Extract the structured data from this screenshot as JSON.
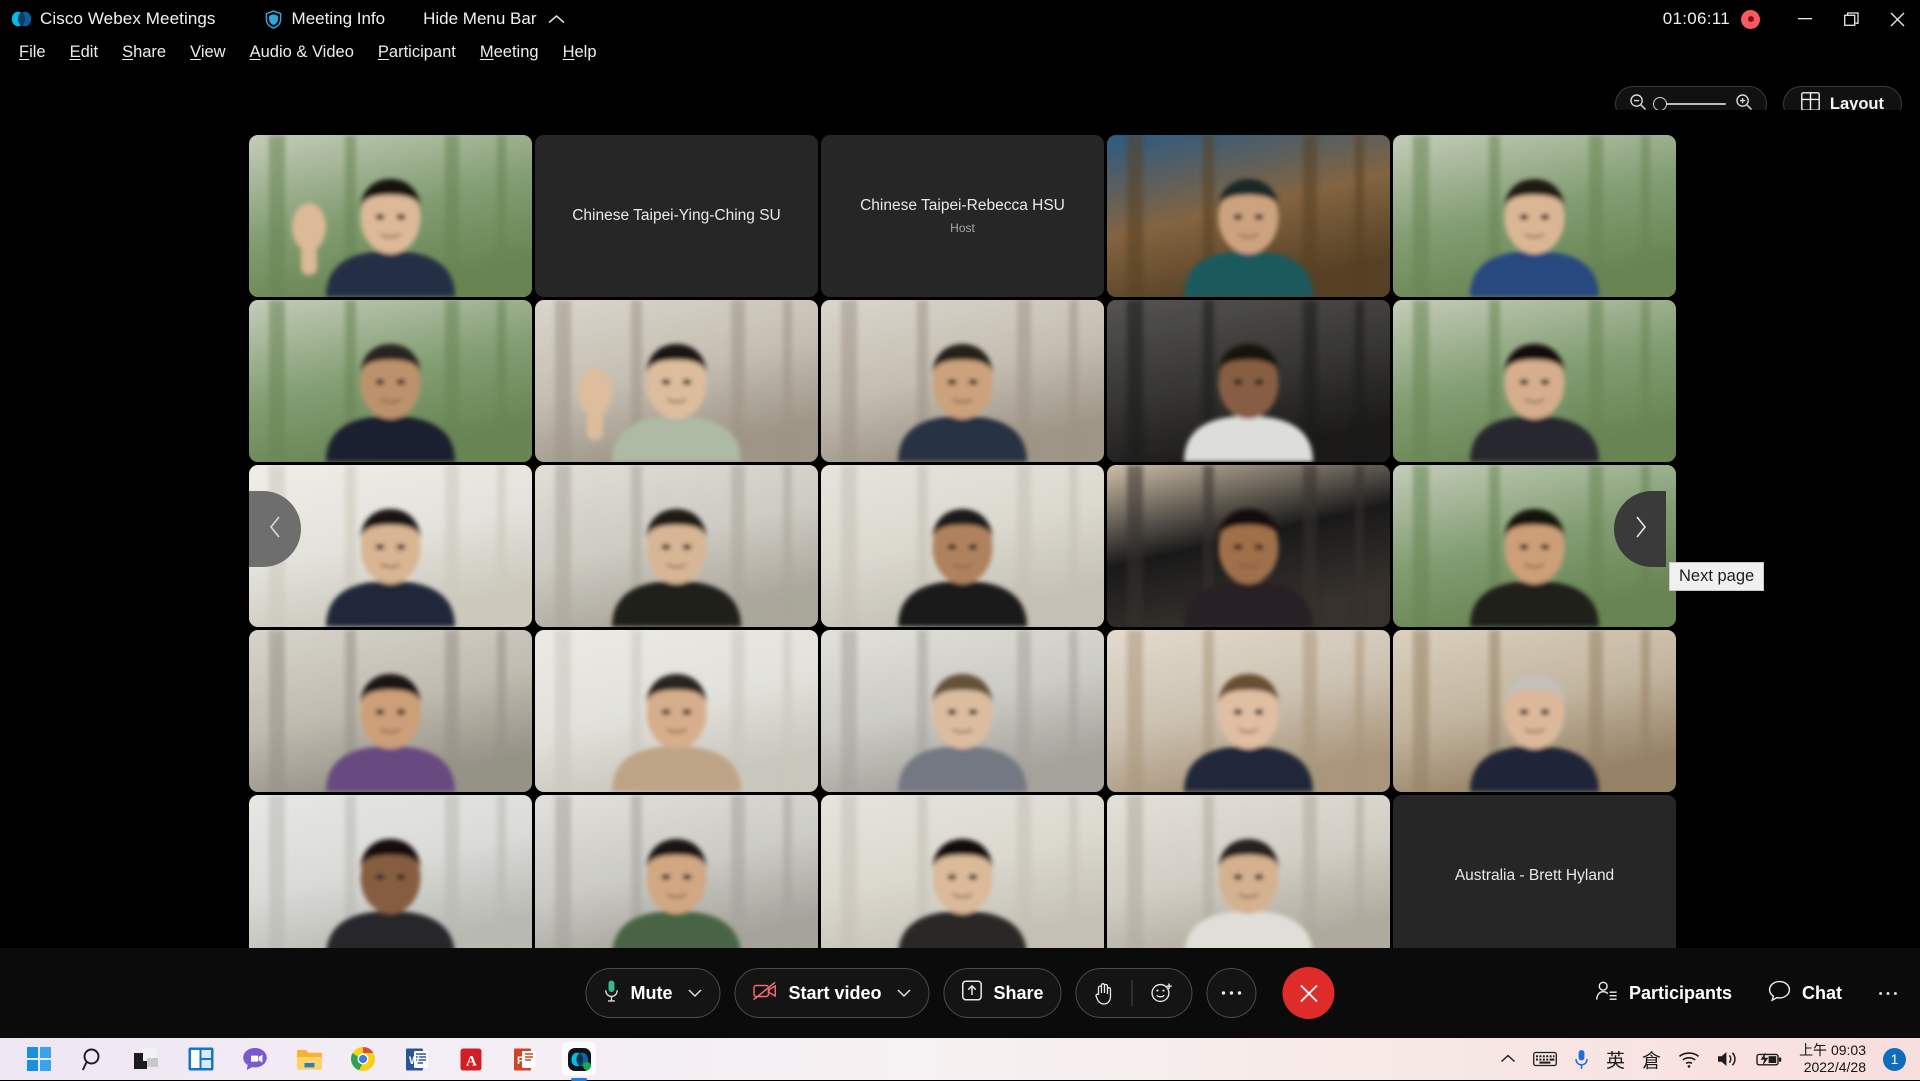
{
  "titlebar": {
    "app_title": "Cisco Webex Meetings",
    "logo_icon": "webex-logo-icon",
    "meeting_info_label": "Meeting Info",
    "meeting_info_icon": "shield-icon",
    "hide_menu_bar_label": "Hide Menu Bar",
    "hide_menu_bar_icon": "chevron-up-icon",
    "timer": "01:06:11",
    "recording_icon": "recording-indicator-icon",
    "minimize_icon": "minimize-icon",
    "restore_icon": "restore-icon",
    "close_icon": "close-icon",
    "accent_recording": "#fa5a5f"
  },
  "menubar": {
    "items": [
      {
        "label": "File",
        "accel": "F"
      },
      {
        "label": "Edit",
        "accel": "E"
      },
      {
        "label": "Share",
        "accel": "S"
      },
      {
        "label": "View",
        "accel": "V"
      },
      {
        "label": "Audio & Video",
        "accel": "A"
      },
      {
        "label": "Participant",
        "accel": "P"
      },
      {
        "label": "Meeting",
        "accel": "M"
      },
      {
        "label": "Help",
        "accel": "H"
      }
    ]
  },
  "topcontrols": {
    "zoom_out_icon": "zoom-out-icon",
    "zoom_in_icon": "zoom-in-icon",
    "zoom_value": 0,
    "layout_label": "Layout",
    "layout_icon": "grid-layout-icon"
  },
  "stage": {
    "prev_page_icon": "chevron-left-icon",
    "next_page_icon": "chevron-right-icon",
    "next_page_tooltip": "Next page",
    "grid_columns": 5,
    "grid_rows": 5,
    "tiles": [
      {
        "type": "video",
        "bg": "forest",
        "subject": "man-waving-glasses"
      },
      {
        "type": "name",
        "name": "Chinese Taipei-Ying-Ching SU",
        "role": ""
      },
      {
        "type": "name",
        "name": "Chinese Taipei-Rebecca HSU",
        "role": "Host"
      },
      {
        "type": "video",
        "bg": "office-flag",
        "subject": "woman-hijab-teal"
      },
      {
        "type": "video",
        "bg": "forest",
        "subject": "woman-blue-top"
      },
      {
        "type": "video",
        "bg": "forest",
        "subject": "man-suit-tie"
      },
      {
        "type": "video",
        "bg": "office",
        "subject": "man-mask-waving"
      },
      {
        "type": "video",
        "bg": "office",
        "subject": "man-navy-shirt"
      },
      {
        "type": "video",
        "bg": "dark-room",
        "subject": "man-pink-mask"
      },
      {
        "type": "video",
        "bg": "forest",
        "subject": "woman-dark-hair"
      },
      {
        "type": "video",
        "bg": "chart-backdrop",
        "subject": "man-suit-speaking"
      },
      {
        "type": "video",
        "bg": "office-lab",
        "subject": "woman-black-jacket"
      },
      {
        "type": "video",
        "bg": "plain-wall",
        "subject": "woman-hijab-glasses"
      },
      {
        "type": "video",
        "bg": "poster-wall",
        "subject": "woman-looking-down"
      },
      {
        "type": "video",
        "bg": "forest",
        "subject": "woman-glasses-smiling"
      },
      {
        "type": "video",
        "bg": "office-cabinet",
        "subject": "man-purple-shirt"
      },
      {
        "type": "video",
        "bg": "banner-backdrop",
        "subject": "woman-hijab-beige"
      },
      {
        "type": "video",
        "bg": "open-office",
        "subject": "woman-headset"
      },
      {
        "type": "video",
        "bg": "home-room",
        "subject": "man-beard-blazer"
      },
      {
        "type": "video",
        "bg": "home-study",
        "subject": "man-orange-tie"
      },
      {
        "type": "video",
        "bg": "bright-window",
        "subject": "man-dark-shirt"
      },
      {
        "type": "video",
        "bg": "open-office",
        "subject": "woman-headset-green"
      },
      {
        "type": "video",
        "bg": "plain-wall",
        "subject": "woman-young"
      },
      {
        "type": "video",
        "bg": "home-wall",
        "subject": "person-glasses-white"
      },
      {
        "type": "name",
        "name": "Australia - Brett Hyland",
        "role": ""
      }
    ]
  },
  "toolbar": {
    "mute_label": "Mute",
    "mute_icon": "microphone-icon",
    "mute_chevron_icon": "chevron-down-icon",
    "start_video_label": "Start video",
    "start_video_icon": "camera-off-icon",
    "start_video_chevron_icon": "chevron-down-icon",
    "share_label": "Share",
    "share_icon": "share-screen-icon",
    "raise_hand_icon": "raise-hand-icon",
    "reactions_icon": "emoji-reaction-icon",
    "more_options_icon": "more-horizontal-icon",
    "end_meeting_icon": "end-call-close-icon",
    "participants_label": "Participants",
    "participants_icon": "participants-icon",
    "chat_label": "Chat",
    "chat_icon": "chat-bubble-icon",
    "more_panel_icon": "more-horizontal-icon",
    "mic_color": "#34b88c",
    "camera_off_color": "#f06a72",
    "end_call_color": "#e02b2b"
  },
  "taskbar": {
    "apps": [
      {
        "name": "start-button",
        "icon": "windows-logo-icon",
        "running": false,
        "active": false
      },
      {
        "name": "search-button",
        "icon": "search-icon",
        "running": false,
        "active": false
      },
      {
        "name": "task-view-button",
        "icon": "task-view-icon",
        "running": false,
        "active": false
      },
      {
        "name": "widgets-button",
        "icon": "widgets-icon",
        "running": false,
        "active": false
      },
      {
        "name": "chat-teams-button",
        "icon": "teams-chat-icon",
        "running": false,
        "active": false
      },
      {
        "name": "file-explorer-button",
        "icon": "file-explorer-icon",
        "running": true,
        "active": false
      },
      {
        "name": "chrome-button",
        "icon": "chrome-icon",
        "running": true,
        "active": false
      },
      {
        "name": "word-button",
        "icon": "word-icon",
        "running": true,
        "active": false
      },
      {
        "name": "acrobat-button",
        "icon": "acrobat-reader-icon",
        "running": true,
        "active": false
      },
      {
        "name": "powerpoint-button",
        "icon": "powerpoint-icon",
        "running": true,
        "active": false
      },
      {
        "name": "webex-button",
        "icon": "webex-logo-icon",
        "running": true,
        "active": true
      }
    ],
    "tray": {
      "overflow_icon": "chevron-up-icon",
      "keyboard_icon": "touch-keyboard-icon",
      "microphone_icon": "microphone-icon",
      "ime_mode": "英",
      "ime_method": "倉",
      "wifi_icon": "wifi-icon",
      "volume_icon": "volume-icon",
      "battery_icon": "battery-charging-icon",
      "time": "上午 09:03",
      "date": "2022/4/28",
      "notification_count": "1"
    }
  }
}
